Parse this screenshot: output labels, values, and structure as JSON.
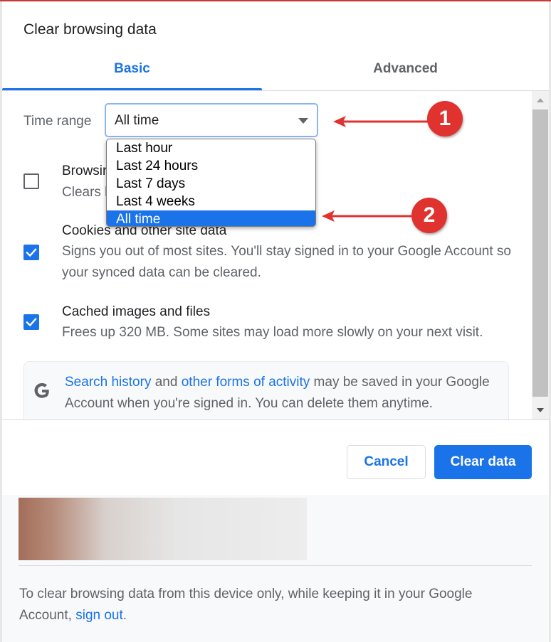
{
  "dialog": {
    "title": "Clear browsing data",
    "tabs": [
      {
        "label": "Basic",
        "active": true
      },
      {
        "label": "Advanced",
        "active": false
      }
    ]
  },
  "time_range": {
    "label": "Time range",
    "selected": "All time",
    "options": [
      "Last hour",
      "Last 24 hours",
      "Last 7 days",
      "Last 4 weeks",
      "All time"
    ]
  },
  "items": [
    {
      "title": "Browsing history",
      "visible_title": "Browsir",
      "desc": "Clears l",
      "checked": false
    },
    {
      "title": "Cookies and other site data",
      "desc": "Signs you out of most sites. You'll stay signed in to your Google Account so your synced data can be cleared.",
      "checked": true
    },
    {
      "title": "Cached images and files",
      "desc": "Frees up 320 MB. Some sites may load more slowly on your next visit.",
      "checked": true
    }
  ],
  "info": {
    "icon": "google-g-icon",
    "link1": "Search history",
    "text1": " and ",
    "link2": "other forms of activity",
    "text2": " may be saved in your Google Account when you're signed in. You can delete them anytime."
  },
  "buttons": {
    "cancel": "Cancel",
    "clear": "Clear data"
  },
  "footer": {
    "text": "To clear browsing data from this device only, while keeping it in your Google Account, ",
    "link": "sign out",
    "end": "."
  },
  "annotations": [
    {
      "number": "1"
    },
    {
      "number": "2"
    }
  ],
  "colors": {
    "accent": "#1a73e8",
    "annotation": "#e0322f"
  }
}
